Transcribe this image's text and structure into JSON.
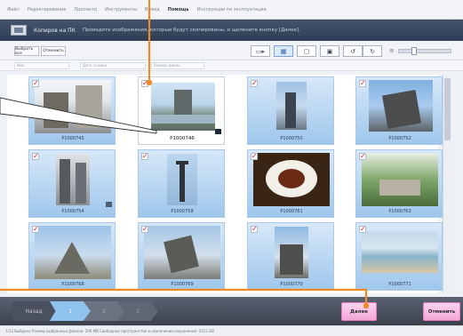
{
  "menu": {
    "items": [
      "Файл",
      "Редактирование",
      "Просмотр",
      "Инструменты",
      "Вывод",
      "Помощь",
      "Инструкции по эксплуатации"
    ],
    "active_index": 5
  },
  "title": {
    "text": "Копиров на ПК",
    "instruction": "Проведите изображения, которые будут скопированы, и щелкните кнопку [Далее]."
  },
  "toolbar": {
    "select_all_label": "Выбрать все",
    "deselect_label": "Отменить"
  },
  "fields": {
    "labels": [
      "Имя",
      "Дата съемки",
      "Размер файла"
    ]
  },
  "grid": {
    "tiles": [
      {
        "label": "P1000745",
        "checked": true,
        "selected": false
      },
      {
        "label": "P1000746",
        "checked": true,
        "selected": true
      },
      {
        "label": "P1000750",
        "checked": true,
        "selected": false
      },
      {
        "label": "P1000752",
        "checked": true,
        "selected": false
      },
      {
        "label": "P1000754",
        "checked": true,
        "selected": false
      },
      {
        "label": "P1000758",
        "checked": true,
        "selected": false
      },
      {
        "label": "P1000761",
        "checked": true,
        "selected": false
      },
      {
        "label": "P1000763",
        "checked": true,
        "selected": false
      },
      {
        "label": "P1000768",
        "checked": true,
        "selected": false
      },
      {
        "label": "P1000769",
        "checked": true,
        "selected": false
      },
      {
        "label": "P1000770",
        "checked": true,
        "selected": false
      },
      {
        "label": "P1000771",
        "checked": true,
        "selected": false
      }
    ]
  },
  "steps": {
    "back_label": "Назад",
    "step_1": "1",
    "step_2": "2",
    "step_3": "3"
  },
  "buttons": {
    "next_label": "Далее",
    "cancel_label": "Отменить"
  },
  "status": {
    "text": "1/12 Выбрано  Размер выбранных файлов: 290 MB  Свободное пространство в назначении сохранения: 5115 GB"
  },
  "colors": {
    "annotation_orange": "#f08a24",
    "title_bar": "#3a4a62",
    "tile_blue": "#a9cdef",
    "pink_button": "#f6b6de",
    "check_red": "#d0102a"
  },
  "icons": {
    "check": "check-mark-icon",
    "rotate": "rotation-badge-icon"
  }
}
